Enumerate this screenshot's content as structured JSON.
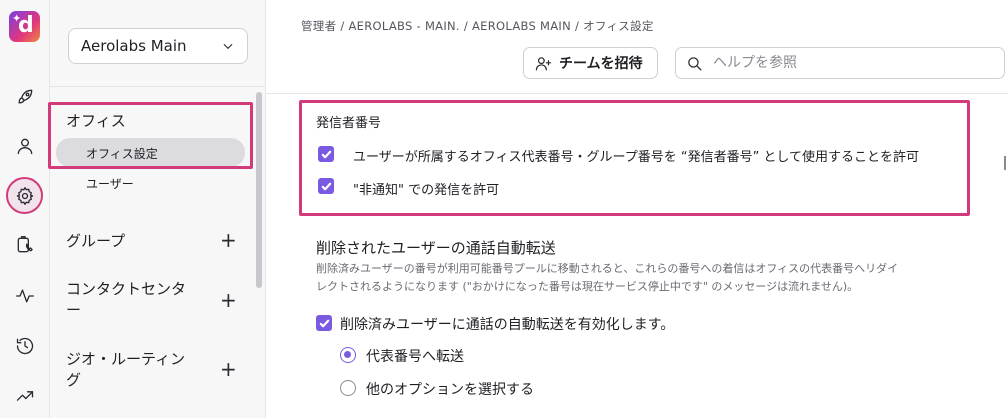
{
  "rail": {
    "icons": [
      "rocket-icon",
      "user-icon",
      "gear-icon",
      "clipboard-call-icon",
      "activity-icon",
      "history-icon",
      "trending-icon"
    ],
    "active": "gear-icon",
    "accent_color": "#d23b7a"
  },
  "sidenav": {
    "workspace": "Aerolabs Main",
    "sections": [
      {
        "label": "オフィス",
        "items": [
          {
            "label": "オフィス設定",
            "active": true
          },
          {
            "label": "ユーザー",
            "active": false
          }
        ]
      },
      {
        "label": "グループ",
        "expand": "+"
      },
      {
        "label_line1": "コンタクトセンタ",
        "label_line2": "ー",
        "expand": "+"
      },
      {
        "label_line1": "ジオ・ルーティン",
        "label_line2": "グ",
        "expand": "+"
      }
    ]
  },
  "header": {
    "breadcrumb": "管理者 / AEROLABS - MAIN. / AEROLABS MAIN / オフィス設定",
    "invite_label": "チームを招待",
    "search_placeholder": "ヘルプを参照"
  },
  "caller_id": {
    "title": "発信者番号",
    "options": [
      {
        "label": "ユーザーが所属するオフィス代表番号・グループ番号を “発信者番号” として使用することを許可",
        "checked": true
      },
      {
        "label": "\"非通知\" での発信を許可",
        "checked": true
      }
    ]
  },
  "forwarding": {
    "title": "削除されたユーザーの通話自動転送",
    "description": "削除済みユーザーの番号が利用可能番号プールに移動されると、これらの番号への着信はオフィスの代表番号へリダイレクトされるようになります (\"おかけになった番号は現在サービス停止中です\" のメッセージは流れません)。",
    "enable_label": "削除済みユーザーに通話の自動転送を有効化します。",
    "enable_checked": true,
    "radio_options": [
      {
        "label": "代表番号へ転送",
        "selected": true
      },
      {
        "label": "他のオプションを選択する",
        "selected": false
      }
    ]
  },
  "colors": {
    "checkbox": "#7a5ae0",
    "highlight": "#d23b7a"
  }
}
